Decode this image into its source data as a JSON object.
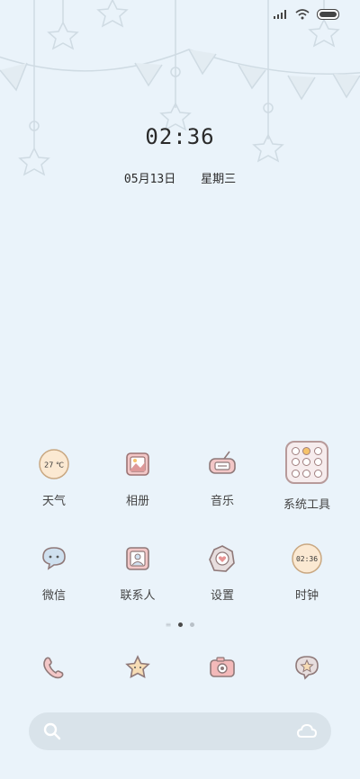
{
  "statusbar": {
    "signal_icon": "signal-bars-icon",
    "wifi_icon": "wifi-icon",
    "battery_icon": "battery-icon"
  },
  "lockclock": {
    "time": "02:36",
    "date": "05月13日",
    "weekday": "星期三"
  },
  "apps": [
    {
      "label": "天气",
      "badge": "27 ℃",
      "icon": "weather-icon"
    },
    {
      "label": "相册",
      "icon": "gallery-icon"
    },
    {
      "label": "音乐",
      "icon": "radio-icon"
    },
    {
      "label": "系统工具",
      "icon": "folder-icon"
    },
    {
      "label": "微信",
      "icon": "chat-bubble-icon"
    },
    {
      "label": "联系人",
      "icon": "contact-card-icon"
    },
    {
      "label": "设置",
      "icon": "settings-heart-icon"
    },
    {
      "label": "时钟",
      "badge": "02:36",
      "icon": "clock-icon"
    }
  ],
  "dock": [
    {
      "icon": "phone-icon"
    },
    {
      "icon": "star-icon"
    },
    {
      "icon": "camera-icon"
    },
    {
      "icon": "star-bubble-icon"
    }
  ],
  "search": {
    "left_icon": "search-icon",
    "right_icon": "cloud-icon"
  },
  "colors": {
    "background": "#eaf3fa",
    "icon_fill": "#f6ead8",
    "icon_stroke": "#8f7979",
    "accent": "#e89494"
  }
}
